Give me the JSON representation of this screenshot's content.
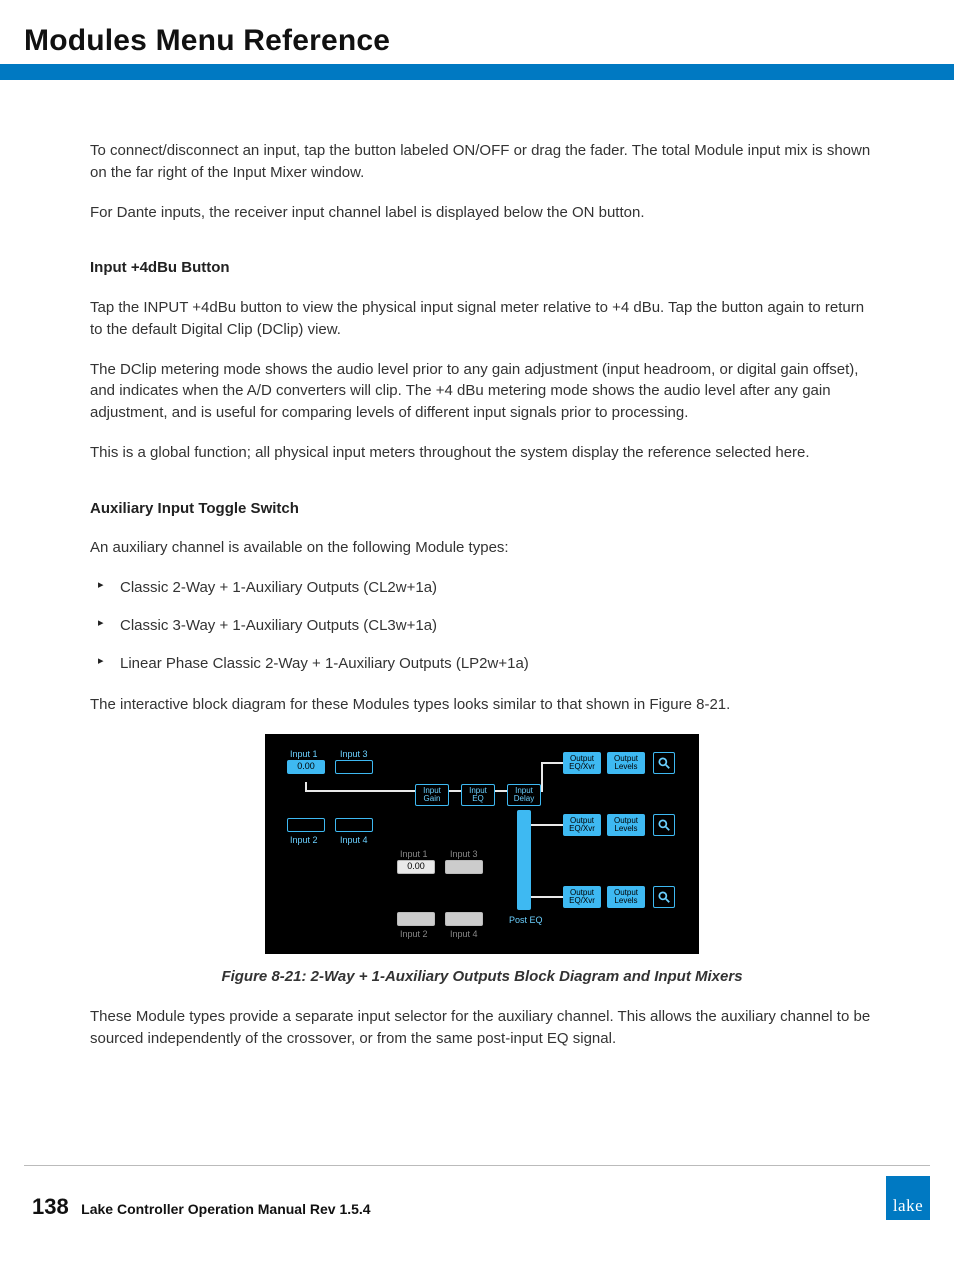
{
  "header": {
    "title": "Modules Menu Reference"
  },
  "body": {
    "p1": "To connect/disconnect an input, tap the button labeled ON/OFF or drag the fader. The total Module input mix is shown on the far right of the Input Mixer window.",
    "p2": "For Dante inputs, the receiver input channel label is displayed below the ON button.",
    "h1": "Input +4dBu Button",
    "p3": "Tap the INPUT +4dBu button to view the physical input signal meter relative to +4 dBu. Tap the button again to return to the default Digital Clip (DClip) view.",
    "p4": "The DClip metering mode shows the audio level prior to any gain adjustment (input headroom, or digital gain offset), and indicates when the A/D converters will clip. The +4 dBu metering mode shows the audio level after any gain adjustment, and is useful for comparing levels of different input signals prior to processing.",
    "p5": "This is a global function; all physical input meters throughout the system display the reference selected here.",
    "h2": "Auxiliary Input Toggle Switch",
    "p6": "An auxiliary channel is available on the following Module types:",
    "list": [
      "Classic 2-Way + 1-Auxiliary Outputs (CL2w+1a)",
      "Classic 3-Way + 1-Auxiliary Outputs (CL3w+1a)",
      "Linear Phase Classic 2-Way + 1-Auxiliary Outputs (LP2w+1a)"
    ],
    "p7": "The interactive block diagram for these Modules types looks similar to that shown in Figure 8-21.",
    "caption": "Figure 8-21: 2-Way + 1-Auxiliary Outputs Block Diagram and Input Mixers",
    "p8": "These Module types provide a separate input selector for the auxiliary channel. This allows the auxiliary channel to be sourced independently of the crossover, or from the same post-input EQ signal."
  },
  "diagram": {
    "input1": "Input 1",
    "input2": "Input 2",
    "input3": "Input 3",
    "input4": "Input 4",
    "val1": "0.00",
    "val2": "0.00",
    "inputGain": "Input\nGain",
    "inputEQ": "Input\nEQ",
    "inputDelay": "Input\nDelay",
    "postEQ": "Post EQ",
    "outEQ": "Output\nEQ/Xvr",
    "outLevels": "Output\nLevels"
  },
  "footer": {
    "page": "138",
    "manual": "Lake Controller Operation Manual Rev 1.5.4",
    "logo": "lake"
  }
}
